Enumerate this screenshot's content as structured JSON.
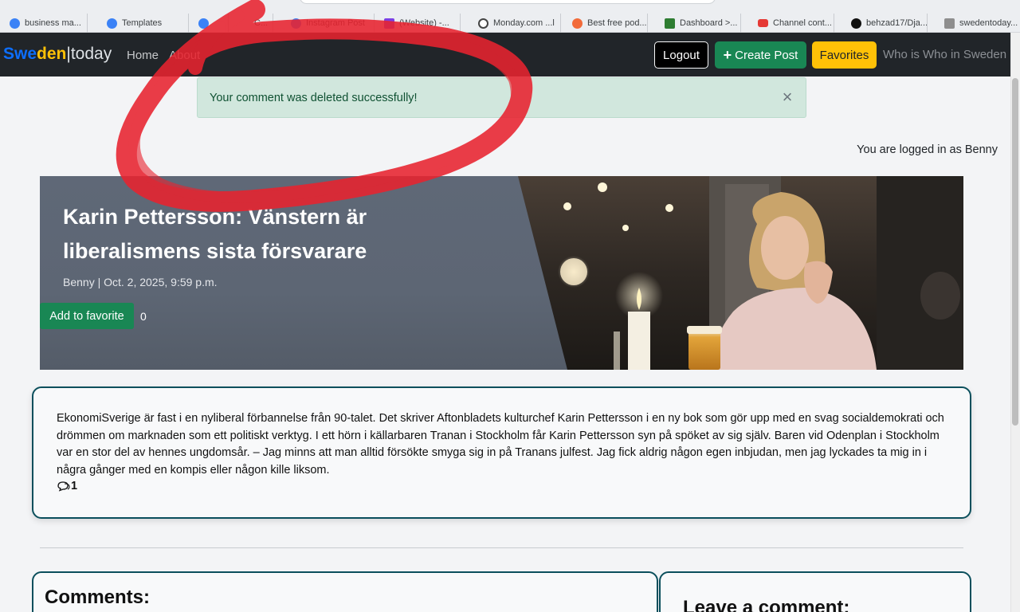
{
  "bookmarks": [
    {
      "label": "business ma...",
      "icon": "canva-icon",
      "color": "#3b82f6"
    },
    {
      "label": "Templates",
      "icon": "canva-icon",
      "color": "#3b82f6"
    },
    {
      "label": "",
      "icon": "canva-icon",
      "color": "#3b82f6"
    },
    {
      "label": "C...",
      "icon": "",
      "color": ""
    },
    {
      "label": "Instagram Post",
      "icon": "canva-icon",
      "color": "#3b82f6"
    },
    {
      "label": "(Website) -...",
      "icon": "monitor-icon",
      "color": "#7b3fe4"
    },
    {
      "label": "Monday.com ...l",
      "icon": "chatgpt-icon",
      "color": "#444"
    },
    {
      "label": "Best free pod...",
      "icon": "podcast-icon",
      "color": "#f26b3a"
    },
    {
      "label": "Dashboard >...",
      "icon": "wifi-icon",
      "color": "#2e7d32"
    },
    {
      "label": "Channel cont...",
      "icon": "youtube-icon",
      "color": "#e53935"
    },
    {
      "label": "behzad17/Dja...",
      "icon": "github-icon",
      "color": "#111"
    },
    {
      "label": "swedentoday...",
      "icon": "heroku-icon",
      "color": "#8e8e8e"
    }
  ],
  "navbar": {
    "brand_part1": "Swe",
    "brand_part2": "den",
    "brand_sep": "|",
    "brand_part3": "today",
    "home": "Home",
    "about": "About",
    "logout": "Logout",
    "create_post": "Create Post",
    "favorites": "Favorites",
    "who_is_who": "Who is Who in Sweden"
  },
  "alert": {
    "message": "Your comment was deleted successfully!",
    "close_symbol": "×"
  },
  "logged_in": "You are logged in as Benny",
  "post": {
    "title": "Karin Pettersson: Vänstern är liberalismens sista försvarare",
    "meta": "Benny | Oct. 2, 2025, 9:59 p.m.",
    "add_favorite": "Add to favorite",
    "favorite_count": "0",
    "excerpt": "EkonomiSverige är fast i en nyliberal förbannelse från 90-talet. Det skriver Aftonbladets kulturchef Karin Pettersson i en ny bok som gör upp med en svag socialdemokrati och drömmen om marknaden som ett politiskt verktyg. I ett hörn i källarbaren Tranan i Stockholm får Karin Pettersson syn på spöket av sig själv. Baren vid Odenplan i Stockholm var en stor del av hennes ungdomsår. – Jag minns att man alltid försökte smyga sig in på Tranans julfest. Jag fick aldrig någon egen inbjudan, men jag lyckades ta mig in i några gånger med en kompis eller någon kille liksom.",
    "comment_count": "1"
  },
  "comments_heading": "Comments:",
  "leave_comment_heading": "Leave a comment:",
  "colors": {
    "navbar_bg": "#212529",
    "success_green": "#198754",
    "warning_yellow": "#ffc107",
    "brand_blue": "#0d6efd",
    "card_border": "#0b4f5c",
    "alert_bg": "#d1e7dd",
    "annotation_red": "#e8232f"
  }
}
